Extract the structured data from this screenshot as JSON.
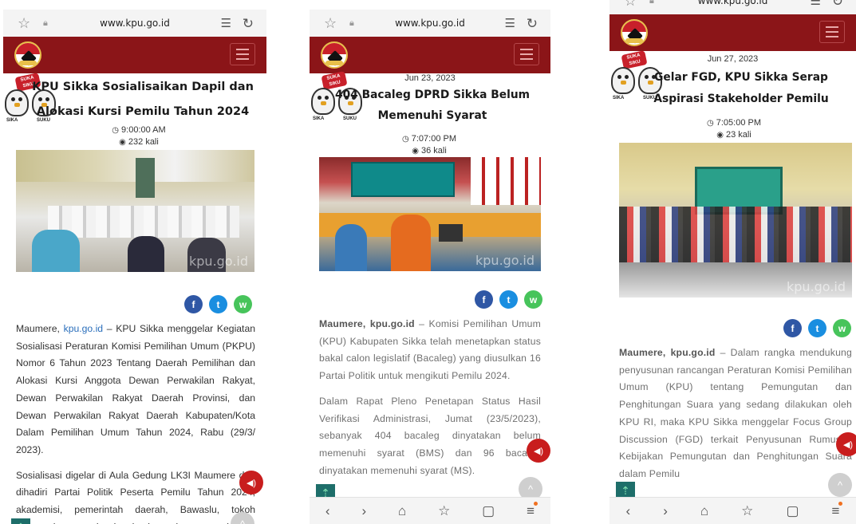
{
  "browser": {
    "url": "www.kpu.go.id",
    "icons": {
      "bookmark": "star-outline-icon",
      "secure": "lock-icon",
      "reader": "reader-mode-icon",
      "reload": "reload-icon"
    }
  },
  "nav": {
    "back": "‹",
    "forward": "›",
    "home": "⌂",
    "bookmarks": "☆",
    "tabs": "▢",
    "menu": "≡"
  },
  "mascot": {
    "bubble": "SUKA SIKU",
    "cap1": "SIKA",
    "cap2": "SUKU"
  },
  "share": {
    "fb": "f",
    "tw": "t",
    "wa": "w"
  },
  "widgets": {
    "audio": "◀)",
    "scroll_top": "^",
    "teal": "⇡"
  },
  "articles": [
    {
      "date": "",
      "title_line1": "KPU Sikka Sosialisaikan Dapil dan",
      "title_line2": "Alokasi Kursi Pemilu Tahun 2024",
      "time": "9:00:00 AM",
      "views": "232 kali",
      "watermark": "kpu.go.id",
      "lead_place": "Maumere, ",
      "lead_link": "kpu.go.id",
      "p1_rest": " – KPU Sikka menggelar Kegiatan Sosialisasi Peraturan Komisi Pemilihan Umum (PKPU) Nomor 6 Tahun 2023 Tentang Daerah Pemilihan dan Alokasi Kursi Anggota Dewan Perwakilan Rakyat, Dewan Perwakilan Rakyat Daerah Provinsi, dan Dewan Perwakilan Rakyat Daerah Kabupaten/Kota Dalam Pemilihan Umum Tahun 2024, Rabu (29/3/ 2023).",
      "p2": "Sosialisasi digelar di Aula Gedung LK3I Maumere dan dihadiri Partai Politik Peserta Pemilu Tahun 2024, akademisi, pemerintah daerah, Bawaslu, tokoh masyarakat, organisasi mahasiswa, dan pemangku"
    },
    {
      "date": "Jun 23, 2023",
      "title_line1": "404 Bacaleg DPRD Sikka Belum",
      "title_line2": "Memenuhi Syarat",
      "time": "7:07:00 PM",
      "views": "36 kali",
      "watermark": "kpu.go.id",
      "lead_strong": "Maumere, kpu.go.id",
      "p1_rest": " – Komisi Pemilihan Umum (KPU) Kabupaten Sikka telah menetapkan status bakal calon legislatif (Bacaleg) yang diusulkan 16 Partai Politik untuk mengikuti Pemilu 2024.",
      "p2": "Dalam Rapat Pleno Penetapan Status Hasil Verifikasi Administrasi, Jumat (23/5/2023), sebanyak 404 bacaleg dinyatakan belum memenuhi syarat (BMS) dan 96 bacaleg dinyatakan memenuhi syarat (MS)."
    },
    {
      "date": "Jun 27, 2023",
      "title_line1": "Gelar FGD, KPU Sikka Serap",
      "title_line2": "Aspirasi Stakeholder Pemilu",
      "time": "7:05:00 PM",
      "views": "23 kali",
      "watermark": "kpu.go.id",
      "lead_strong": "Maumere, kpu.go.id",
      "p1_rest": " – Dalam rangka mendukung penyusunan rancangan Peraturan Komisi Pemilihan Umum (KPU) tentang Pemungutan dan Penghitungan Suara yang sedang dilakukan oleh KPU RI, maka KPU Sikka menggelar Focus Group Discussion (FGD) terkait Penyusunan Rumusan Kebijakan Pemungutan dan Penghitungan Suara dalam Pemilu"
    }
  ]
}
